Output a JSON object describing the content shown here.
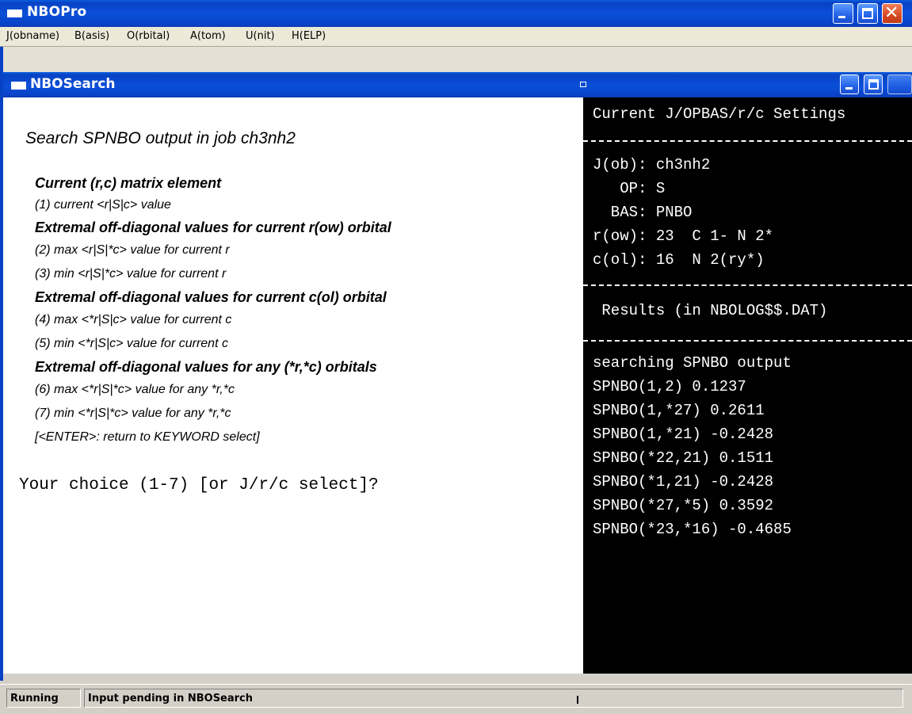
{
  "app": {
    "title": "NBOPro",
    "colors": {
      "titlebar": "#0842c4",
      "close_button": "#d44a22",
      "terminal_bg": "#000000",
      "terminal_fg": "#ffffff"
    }
  },
  "menu": {
    "items": [
      {
        "label": "J(obname)"
      },
      {
        "label": "B(asis)"
      },
      {
        "label": "O(rbital)"
      },
      {
        "label": "A(tom)"
      },
      {
        "label": "U(nit)"
      },
      {
        "label": "H(ELP)"
      }
    ]
  },
  "subwindow": {
    "title": "NBOSearch"
  },
  "search": {
    "title": "Search SPNBO output in job ch3nh2",
    "groups": [
      {
        "heading": "Current (r,c) matrix element",
        "options": [
          "(1) current <r|S|c> value"
        ]
      },
      {
        "heading": "Extremal off-diagonal values for current r(ow) orbital",
        "options": [
          "(2) max <r|S|*c> value for current r",
          "(3) min <r|S|*c> value for current r"
        ]
      },
      {
        "heading": "Extremal off-diagonal values for current c(ol) orbital",
        "options": [
          "(4) max <*r|S|c> value for current c",
          "(5) min <*r|S|c> value for current c"
        ]
      },
      {
        "heading": "Extremal off-diagonal values for any (*r,*c) orbitals",
        "options": [
          "(6) max <*r|S|*c> value for any *r,*c",
          "(7) min <*r|S|*c> value for any *r,*c",
          "[<ENTER>: return to KEYWORD select]"
        ]
      }
    ],
    "prompt": "Your choice (1-7) [or J/r/c select]?"
  },
  "terminal": {
    "header": "Current J/OPBAS/r/c Settings",
    "settings": [
      "J(ob): ch3nh2",
      "   OP: S",
      "  BAS: PNBO",
      "r(ow): 23  C 1- N 2*",
      "c(ol): 16  N 2(ry*)"
    ],
    "results_header": " Results (in NBOLOG$$.DAT)",
    "results": [
      "searching SPNBO output",
      "SPNBO(1,2) 0.1237",
      "SPNBO(1,*27) 0.2611",
      "SPNBO(1,*21) -0.2428",
      "SPNBO(*22,21) 0.1511",
      "SPNBO(*1,21) -0.2428",
      "SPNBO(*27,*5) 0.3592",
      "SPNBO(*23,*16) -0.4685"
    ]
  },
  "status": {
    "state": "Running",
    "message": "Input pending in NBOSearch"
  }
}
